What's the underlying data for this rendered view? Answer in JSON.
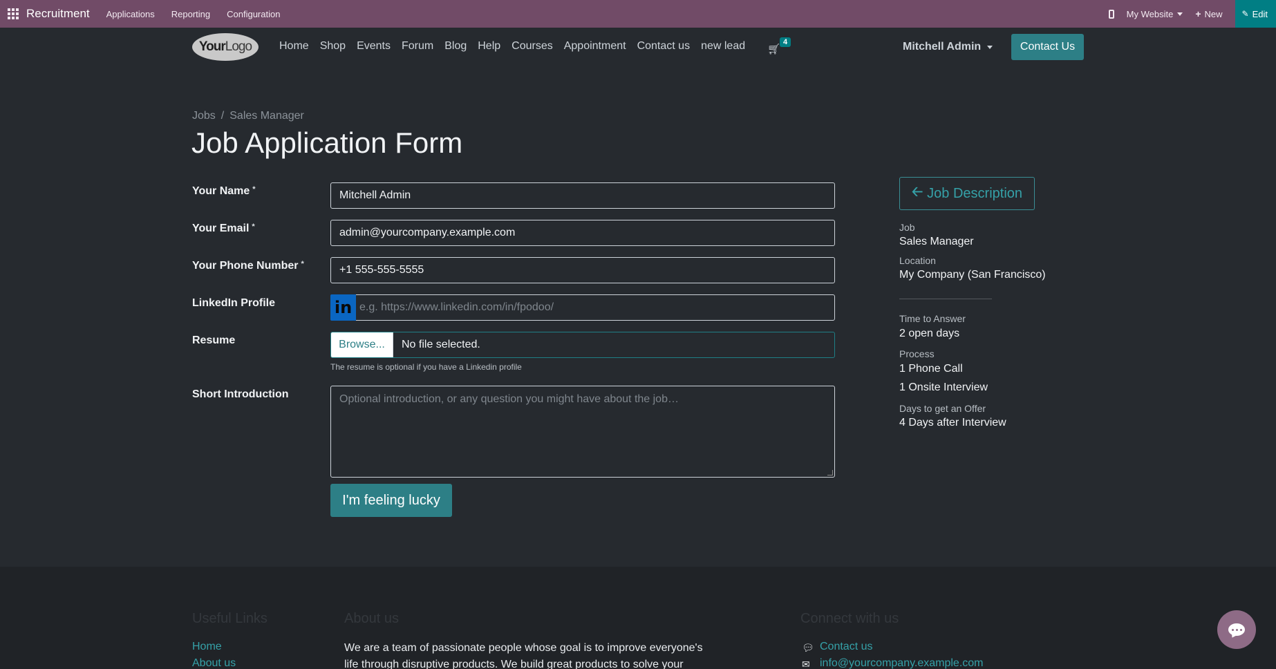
{
  "admin_bar": {
    "app_name": "Recruitment",
    "menu": [
      "Applications",
      "Reporting",
      "Configuration"
    ],
    "website_label": "My Website",
    "new_label": "New",
    "edit_label": "Edit",
    "accent": "#714b67",
    "edit_color": "#017e84"
  },
  "header": {
    "logo_text_bold": "Your",
    "logo_text": "Logo",
    "nav": [
      "Home",
      "Shop",
      "Events",
      "Forum",
      "Blog",
      "Help",
      "Courses",
      "Appointment",
      "Contact us",
      "new lead"
    ],
    "cart_count": "4",
    "user_name": "Mitchell Admin",
    "contact_button": "Contact Us"
  },
  "breadcrumb": {
    "parent": "Jobs",
    "separator": "/",
    "current": "Sales Manager"
  },
  "page_title": "Job Application Form",
  "form": {
    "required_marker": "*",
    "name_label": "Your Name",
    "name_value": "Mitchell Admin",
    "email_label": "Your Email",
    "email_value": "admin@yourcompany.example.com",
    "phone_label": "Your Phone Number",
    "phone_value": "+1 555-555-5555",
    "linkedin_label": "LinkedIn Profile",
    "linkedin_icon_text": "in",
    "linkedin_placeholder": "e.g. https://www.linkedin.com/in/fpodoo/",
    "resume_label": "Resume",
    "browse_label": "Browse...",
    "file_status": "No file selected.",
    "resume_help": "The resume is optional if you have a Linkedin profile",
    "intro_label": "Short Introduction",
    "intro_placeholder": "Optional introduction, or any question you might have about the job…",
    "submit_label": "I'm feeling lucky"
  },
  "aside": {
    "job_description_button": "Job Description",
    "job_caption": "Job",
    "job_value": "Sales Manager",
    "location_caption": "Location",
    "location_value": "My Company (San Francisco)",
    "time_caption": "Time to Answer",
    "time_value": "2 open days",
    "process_caption": "Process",
    "process_steps": [
      "1 Phone Call",
      "1 Onsite Interview"
    ],
    "offer_caption": "Days to get an Offer",
    "offer_value": "4 Days after Interview"
  },
  "footer": {
    "useful_links_title": "Useful Links",
    "links": [
      "Home",
      "About us"
    ],
    "about_title": "About us",
    "about_text": "We are a team of passionate people whose goal is to improve everyone's life through disruptive products. We build great products to solve your",
    "connect_title": "Connect with us",
    "contact_link": "Contact us",
    "email_link": "info@yourcompany.example.com"
  }
}
